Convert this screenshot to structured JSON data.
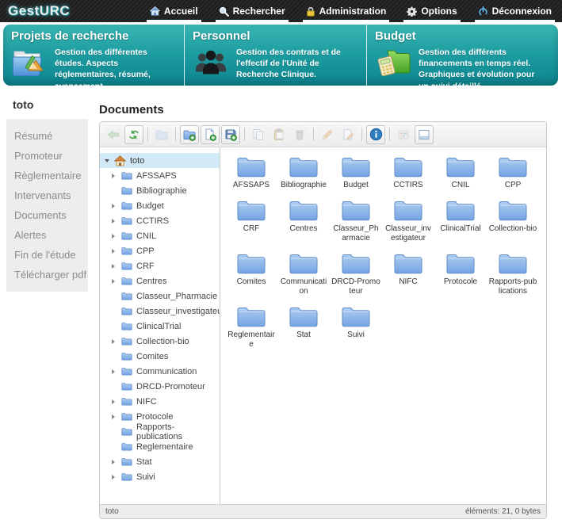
{
  "header": {
    "logo": "GestURC",
    "nav": [
      {
        "label": "Accueil",
        "icon": "home-icon"
      },
      {
        "label": "Rechercher",
        "icon": "search-icon"
      },
      {
        "label": "Administration",
        "icon": "lock-icon"
      },
      {
        "label": "Options",
        "icon": "gear-icon"
      },
      {
        "label": "Déconnexion",
        "icon": "power-icon"
      }
    ]
  },
  "banner": {
    "cards": [
      {
        "title": "Projets de recherche",
        "icon": "projects-folder-icon",
        "description": "Gestion des différentes études. Aspects réglementaires, résumé, avancement ..."
      },
      {
        "title": "Personnel",
        "icon": "people-icon",
        "description": "Gestion des contrats et de l'effectif de l'Unité de Recherche Clinique."
      },
      {
        "title": "Budget",
        "icon": "budget-folder-icon",
        "description": "Gestion des différents financements en temps réel. Graphiques et évolution pour un suivi détaillé."
      }
    ]
  },
  "sidebar": {
    "project": "toto",
    "items": [
      "Résumé",
      "Promoteur",
      "Règlementaire",
      "Intervenants",
      "Documents",
      "Alertes",
      "Fin de l'étude",
      "Télécharger pdf"
    ]
  },
  "main": {
    "title": "Documents",
    "toolbar": [
      {
        "name": "back-button",
        "icon": "arrow-left-icon",
        "enabled": false
      },
      {
        "name": "refresh-button",
        "icon": "refresh-icon",
        "enabled": true
      },
      {
        "separator": true
      },
      {
        "name": "open-folder-button",
        "icon": "open-folder-icon",
        "enabled": false
      },
      {
        "separator": true
      },
      {
        "name": "new-folder-button",
        "icon": "new-folder-icon",
        "enabled": true
      },
      {
        "name": "new-file-button",
        "icon": "new-file-icon",
        "enabled": true
      },
      {
        "name": "save-button",
        "icon": "save-icon",
        "enabled": true
      },
      {
        "separator": true
      },
      {
        "name": "copy-button",
        "icon": "copy-icon",
        "enabled": false
      },
      {
        "name": "paste-button",
        "icon": "paste-icon",
        "enabled": false
      },
      {
        "name": "delete-button",
        "icon": "delete-icon",
        "enabled": false
      },
      {
        "separator": true
      },
      {
        "name": "edit-button",
        "icon": "pencil-icon",
        "enabled": false
      },
      {
        "name": "rename-button",
        "icon": "rename-icon",
        "enabled": false
      },
      {
        "separator": true
      },
      {
        "name": "info-button",
        "icon": "info-icon",
        "enabled": true
      },
      {
        "separator": true
      },
      {
        "name": "thumbnails-view-button",
        "icon": "thumbnails-icon",
        "enabled": false
      },
      {
        "name": "details-view-button",
        "icon": "details-view-icon",
        "enabled": true
      }
    ],
    "tree": {
      "root": "toto",
      "nodes": [
        {
          "label": "AFSSAPS",
          "expandable": true
        },
        {
          "label": "Bibliographie",
          "expandable": false
        },
        {
          "label": "Budget",
          "expandable": true
        },
        {
          "label": "CCTIRS",
          "expandable": true
        },
        {
          "label": "CNIL",
          "expandable": true
        },
        {
          "label": "CPP",
          "expandable": true
        },
        {
          "label": "CRF",
          "expandable": true
        },
        {
          "label": "Centres",
          "expandable": true
        },
        {
          "label": "Classeur_Pharmacie",
          "expandable": false
        },
        {
          "label": "Classeur_investigateur",
          "expandable": false
        },
        {
          "label": "ClinicalTrial",
          "expandable": false
        },
        {
          "label": "Collection-bio",
          "expandable": true
        },
        {
          "label": "Comites",
          "expandable": false
        },
        {
          "label": "Communication",
          "expandable": true
        },
        {
          "label": "DRCD-Promoteur",
          "expandable": false
        },
        {
          "label": "NIFC",
          "expandable": true
        },
        {
          "label": "Protocole",
          "expandable": true
        },
        {
          "label": "Rapports-publications",
          "expandable": false
        },
        {
          "label": "Reglementaire",
          "expandable": false
        },
        {
          "label": "Stat",
          "expandable": true
        },
        {
          "label": "Suivi",
          "expandable": true
        }
      ]
    },
    "folders": [
      "AFSSAPS",
      "Bibliographie",
      "Budget",
      "CCTIRS",
      "CNIL",
      "CPP",
      "CRF",
      "Centres",
      "Classeur_Pharmacie",
      "Classeur_investigateur",
      "ClinicalTrial",
      "Collection-bio",
      "Comites",
      "Communication",
      "DRCD-Promoteur",
      "NIFC",
      "Protocole",
      "Rapports-publications",
      "Reglementaire",
      "Stat",
      "Suivi"
    ],
    "status": {
      "left": "toto",
      "right": "éléments: 21, 0 bytes"
    }
  }
}
